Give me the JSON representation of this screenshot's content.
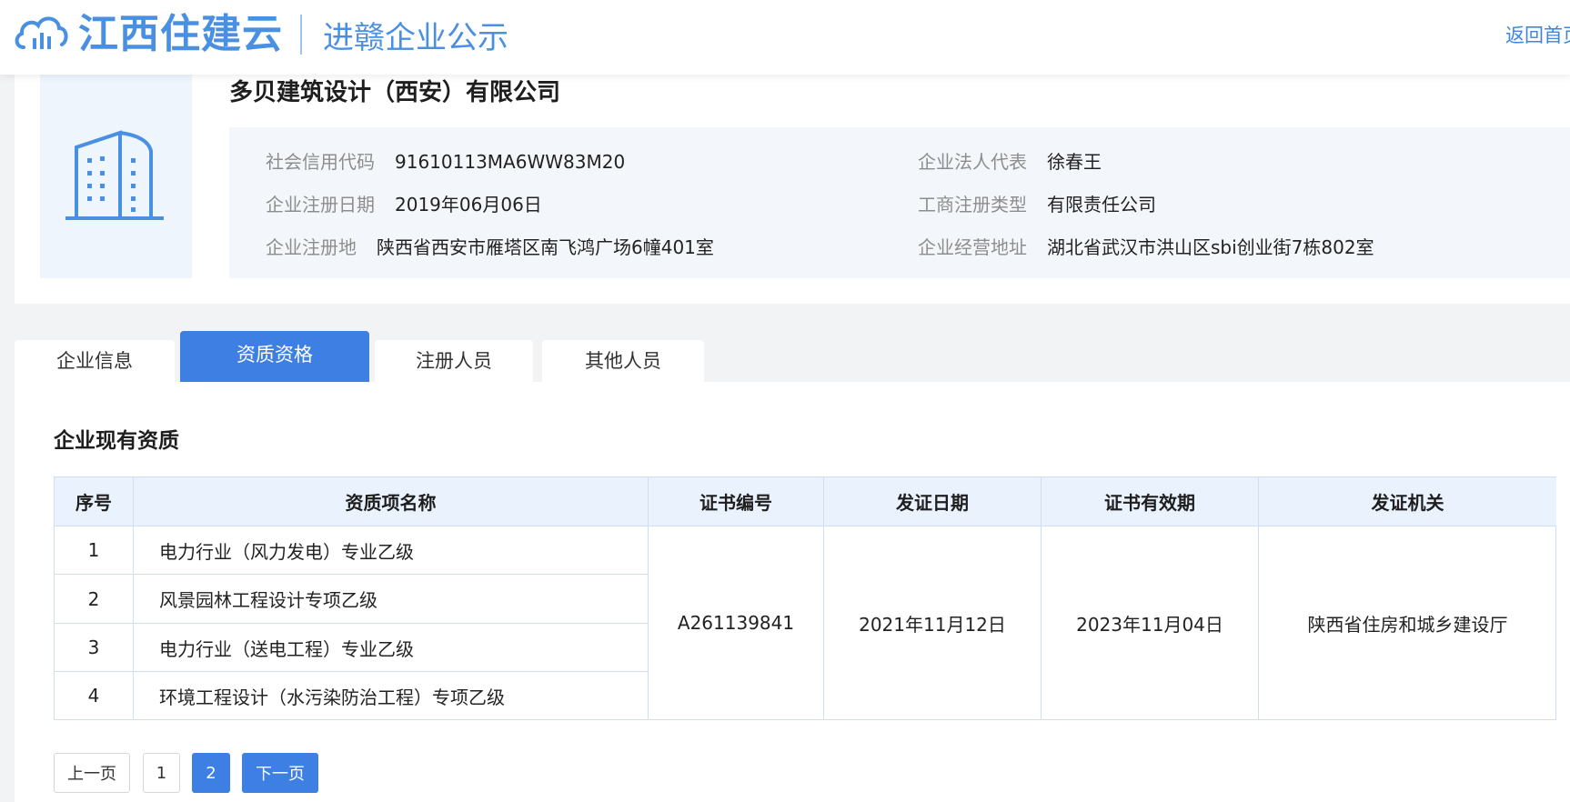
{
  "header": {
    "brand": "江西住建云",
    "subtitle": "进赣企业公示",
    "back_home": "返回首页",
    "brand_color": "#4a90e2"
  },
  "company": {
    "name": "多贝建筑设计（西安）有限公司",
    "logo_icon": "building-icon",
    "fields": {
      "credit_code_label": "社会信用代码",
      "credit_code": "91610113MA6WW83M20",
      "legal_rep_label": "企业法人代表",
      "legal_rep": "徐春王",
      "reg_date_label": "企业注册日期",
      "reg_date": "2019年06月06日",
      "biz_type_label": "工商注册类型",
      "biz_type": "有限责任公司",
      "reg_place_label": "企业注册地",
      "reg_place": "陕西省西安市雁塔区南飞鸿广场6幢401室",
      "op_address_label": "企业经营地址",
      "op_address": "湖北省武汉市洪山区sbi创业街7栋802室"
    }
  },
  "tabs": [
    {
      "label": "企业信息",
      "active": false
    },
    {
      "label": "资质资格",
      "active": true
    },
    {
      "label": "注册人员",
      "active": false
    },
    {
      "label": "其他人员",
      "active": false
    }
  ],
  "section": {
    "title": "企业现有资质"
  },
  "table": {
    "headers": [
      "序号",
      "资质项名称",
      "证书编号",
      "发证日期",
      "证书有效期",
      "发证机关"
    ],
    "rows": [
      {
        "no": "1",
        "name": "电力行业（风力发电）专业乙级"
      },
      {
        "no": "2",
        "name": "风景园林工程设计专项乙级"
      },
      {
        "no": "3",
        "name": "电力行业（送电工程）专业乙级"
      },
      {
        "no": "4",
        "name": "环境工程设计（水污染防治工程）专项乙级"
      }
    ],
    "merged": {
      "cert_no": "A261139841",
      "issue_date": "2021年11月12日",
      "valid_until": "2023年11月04日",
      "authority": "陕西省住房和城乡建设厅"
    }
  },
  "pagination": {
    "prev": "上一页",
    "pages": [
      "1",
      "2"
    ],
    "current": "2",
    "next": "下一页",
    "accent": "#3d7fe3"
  }
}
